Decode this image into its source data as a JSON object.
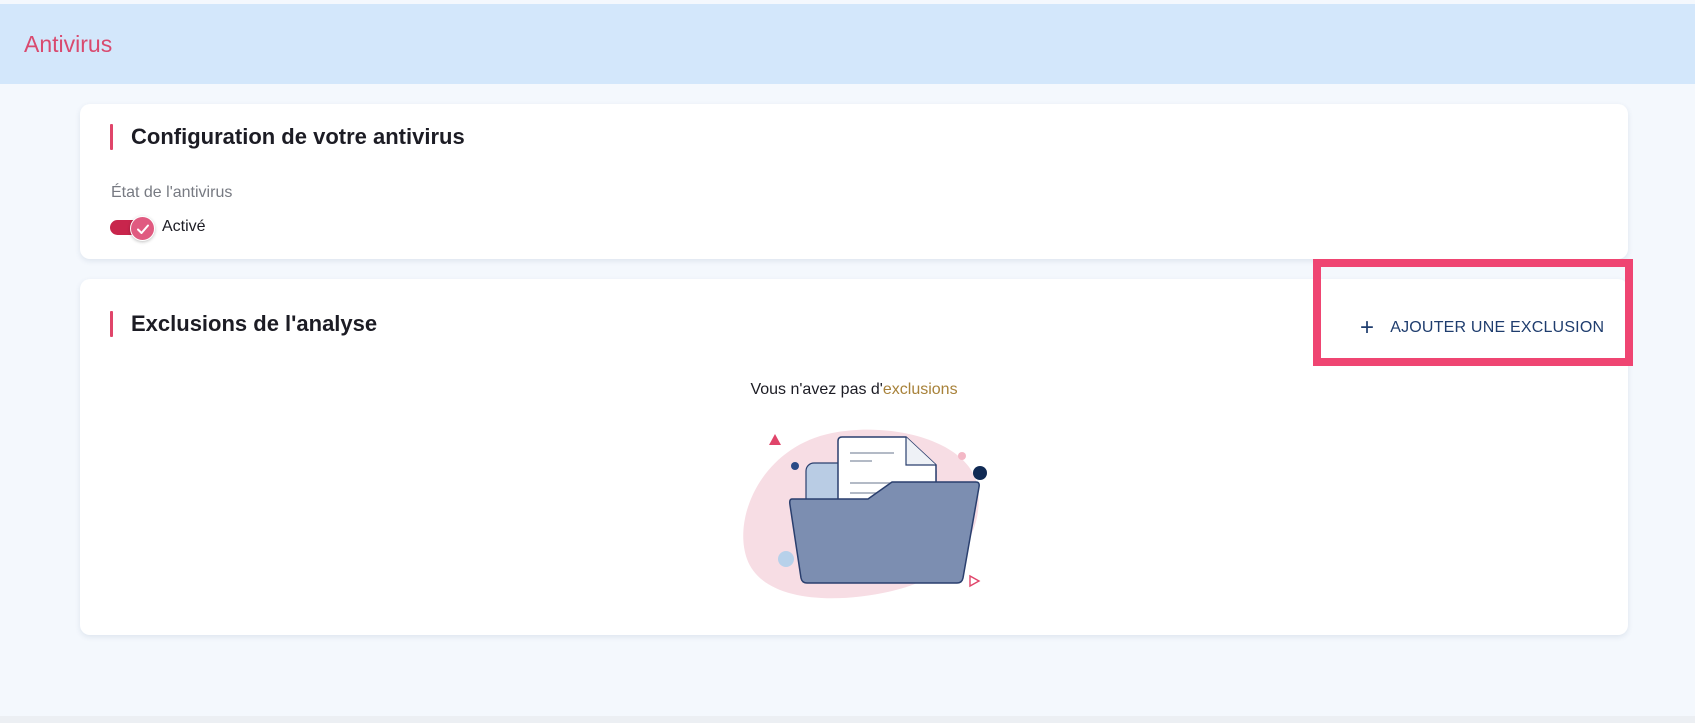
{
  "header": {
    "title": "Antivirus"
  },
  "config_card": {
    "title": "Configuration de votre antivirus",
    "status_label": "État de l'antivirus",
    "toggle_state": "on",
    "toggle_label": "Activé"
  },
  "exclusions_card": {
    "title": "Exclusions de l'analyse",
    "add_button_label": "AJOUTER UNE EXCLUSION",
    "empty_prefix": "Vous n'avez pas d'",
    "empty_accent": "exclusions"
  },
  "icons": {
    "add": "plus-icon",
    "toggle_check": "check-icon",
    "empty_state": "empty-folder-illustration"
  },
  "colors": {
    "accent": "#e0456a",
    "header_bg": "#d3e7fb",
    "button_text": "#1f3d6e",
    "highlight": "#ef4572",
    "empty_accent": "#a8823a"
  }
}
